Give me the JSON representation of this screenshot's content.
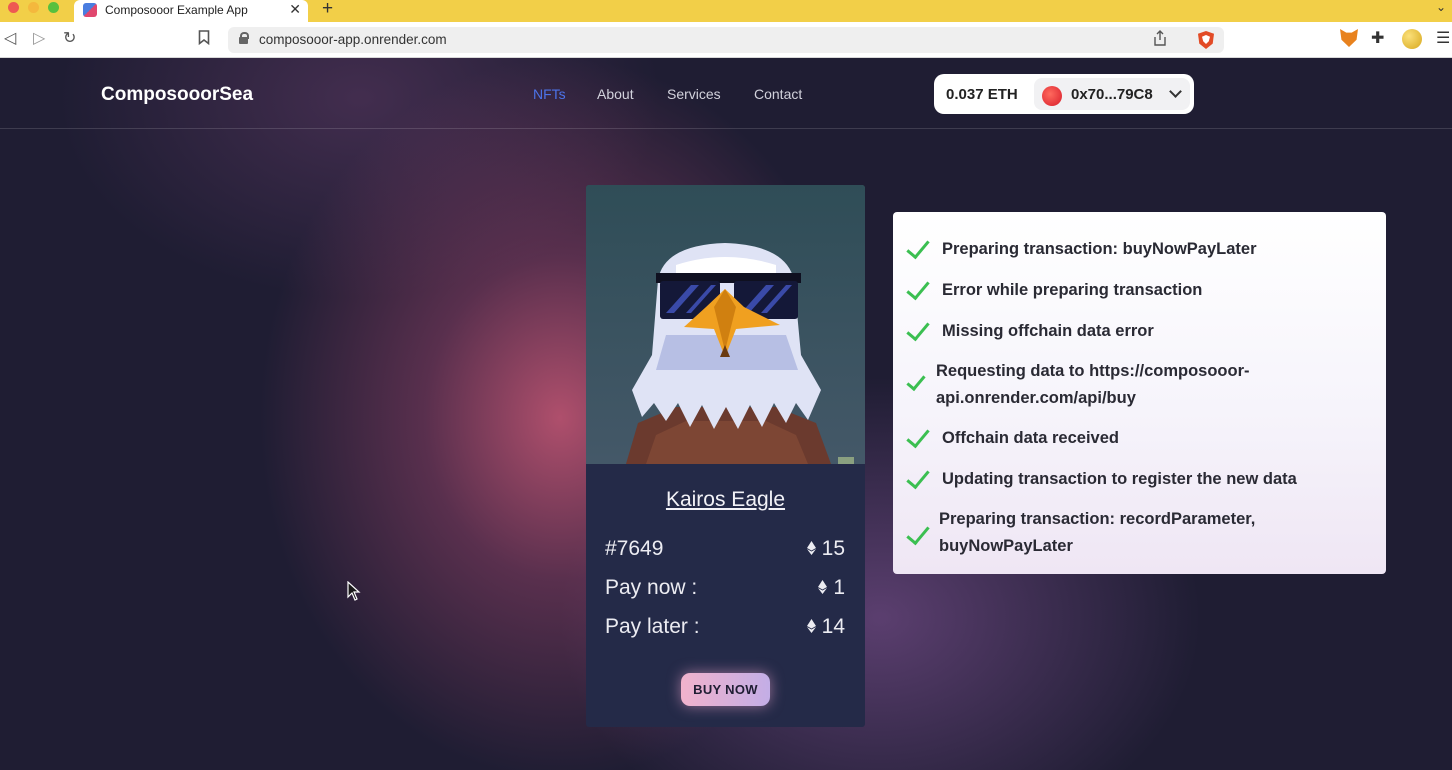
{
  "browser": {
    "tab_title": "Composooor Example App",
    "tab_close": "✕",
    "new_tab": "+",
    "url": "composooor-app.onrender.com"
  },
  "navbar": {
    "logo": "ComposooorSea",
    "links": [
      "NFTs",
      "About",
      "Services",
      "Contact"
    ],
    "active_link": "NFTs",
    "wallet": {
      "balance": "0.037 ETH",
      "address": "0x70...79C8"
    }
  },
  "nft_card": {
    "title": "Kairos Eagle",
    "id": "#7649",
    "price": "15",
    "pay_now_label": "Pay now :",
    "pay_now_value": "1",
    "pay_later_label": "Pay later :",
    "pay_later_value": "14",
    "buy_label": "BUY NOW"
  },
  "status_panel": {
    "items": [
      {
        "text": "Preparing transaction: buyNowPayLater",
        "done": true
      },
      {
        "text": "Error while preparing transaction",
        "done": true
      },
      {
        "text": "Missing offchain data error",
        "done": true
      },
      {
        "text": "Requesting data to https://composooor-api.onrender.com/api/buy",
        "lines": [
          "Requesting data to https://composooor-",
          "api.onrender.com/api/buy"
        ],
        "done": true
      },
      {
        "text": "Offchain data received",
        "done": true
      },
      {
        "text": "Updating transaction to register the new data",
        "done": true
      },
      {
        "text": "Preparing transaction: recordParameter, buyNowPayLater",
        "lines": [
          "Preparing transaction: recordParameter,",
          "buyNowPayLater"
        ],
        "done": true
      }
    ]
  },
  "colors": {
    "tabbar": "#f2cf48",
    "page_bg": "#1f1d33",
    "nav_active": "#4c73e8",
    "card_bg": "#242a48",
    "check": "#3bbf51",
    "buy_gradient_start": "#f1b2cc",
    "buy_gradient_end": "#c3aee6"
  }
}
